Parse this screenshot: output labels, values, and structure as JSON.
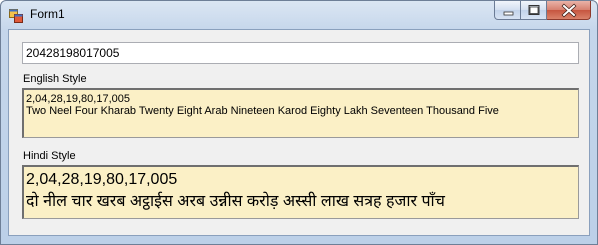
{
  "window": {
    "title": "Form1"
  },
  "input": {
    "value": "20428198017005"
  },
  "english": {
    "label": "English Style",
    "formatted": "2,04,28,19,80,17,005",
    "words": "Two Neel Four Kharab Twenty Eight Arab Nineteen Karod Eighty Lakh Seventeen Thousand Five"
  },
  "hindi": {
    "label": "Hindi Style",
    "formatted": "2,04,28,19,80,17,005",
    "words": "दो नील चार खरब अट्ठाईस अरब उन्नीस करोड़ अस्सी लाख सत्रह हजार पाँच"
  },
  "colors": {
    "panel_background": "#fbf0c6",
    "form_background": "#f0f0f0",
    "title_bar": "#c5d6eb"
  },
  "icons": {
    "app": "winforms-app-icon",
    "minimize": "minimize-icon",
    "maximize": "maximize-icon",
    "close": "close-icon"
  }
}
